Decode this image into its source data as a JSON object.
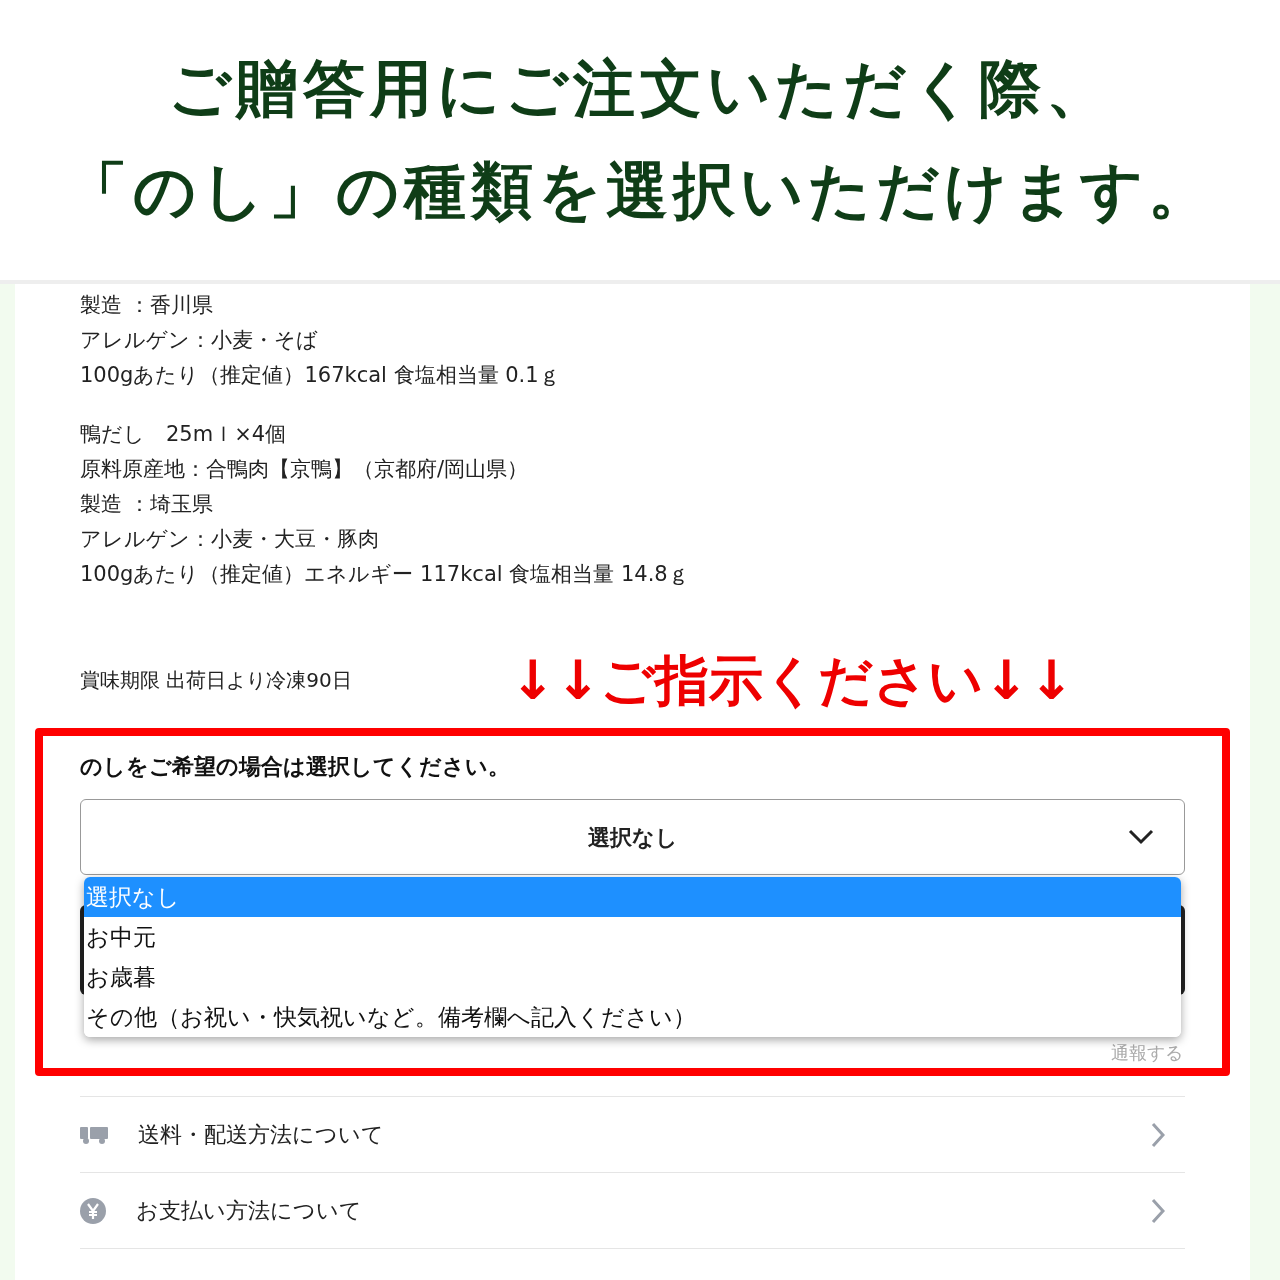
{
  "header": {
    "lines": [
      "ご贈答用にご注文いただく際、",
      "「のし」の種類を選択いただけます。"
    ]
  },
  "spec_groups": [
    {
      "lines": [
        "製造 ：香川県",
        "アレルゲン：小麦・そば",
        "100gあたり（推定値）167kcal 食塩相当量 0.1ｇ"
      ]
    },
    {
      "lines": [
        "鴨だし　25mｌ×4個",
        "原料原産地：合鴨肉【京鴨】（京都府/岡山県）",
        "製造 ：埼玉県",
        "アレルゲン：小麦・大豆・豚肉",
        "100gあたり（推定値）エネルギー 117kcal 食塩相当量 14.8ｇ"
      ]
    }
  ],
  "shelf_life": "賞味期限 出荷日より冷凍90日",
  "annotation": "↓↓ご指示ください↓↓",
  "noshi": {
    "label": "のしをご希望の場合は選択してください。",
    "value": "選択なし",
    "options": [
      {
        "label": "選択なし",
        "selected": true
      },
      {
        "label": "お中元",
        "selected": false
      },
      {
        "label": "お歳暮",
        "selected": false
      },
      {
        "label": "その他（お祝い・快気祝いなど。備考欄へ記入ください）",
        "selected": false
      }
    ],
    "report_link": "通報する"
  },
  "info_links": [
    {
      "kind": "shipping",
      "label": "送料・配送方法について"
    },
    {
      "kind": "payment",
      "label": "お支払い方法について"
    }
  ]
}
